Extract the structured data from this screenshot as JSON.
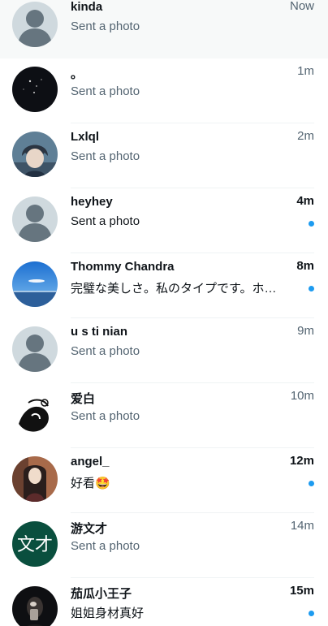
{
  "conversations": [
    {
      "name": "kinda",
      "time": "Now",
      "preview": "Sent a photo",
      "avatar": "default-avatar-icon",
      "unread": false,
      "selected": true
    },
    {
      "name": "。",
      "time": "1m",
      "preview": "Sent a photo",
      "avatar": "night-sky-photo",
      "unread": false,
      "selected": false
    },
    {
      "name": "Lxlql",
      "time": "2m",
      "preview": "Sent a photo",
      "avatar": "anime-boy-photo",
      "unread": false,
      "selected": false
    },
    {
      "name": "heyhey",
      "time": "4m",
      "preview": "Sent a photo",
      "avatar": "default-avatar-icon",
      "unread": true,
      "selected": false
    },
    {
      "name": "Thommy Chandra",
      "time": "8m",
      "preview": "完璧な美しさ。私のタイプです。ホテルで会いましょう",
      "avatar": "blue-sky-photo",
      "unread": true,
      "selected": false
    },
    {
      "name": "u s ti nian",
      "time": "9m",
      "preview": "Sent a photo",
      "avatar": "default-avatar-icon",
      "unread": false,
      "selected": false
    },
    {
      "name": "爱白",
      "time": "10m",
      "preview": "Sent a photo",
      "avatar": "sketch-drawing-photo",
      "unread": false,
      "selected": false
    },
    {
      "name": "angel_",
      "time": "12m",
      "preview": "好看🤩",
      "avatar": "anime-girl-photo",
      "unread": true,
      "selected": false
    },
    {
      "name": "游文才",
      "time": "14m",
      "preview": "Sent a photo",
      "avatar": "initials-avatar",
      "avatar_text": "文才",
      "avatar_color": "#0a4f3e",
      "unread": false,
      "selected": false
    },
    {
      "name": "茄瓜小王子",
      "time": "15m",
      "preview": "姐姐身材真好",
      "avatar": "dark-selfie-photo",
      "unread": true,
      "selected": false
    }
  ],
  "colors": {
    "accent": "#1d9bf0",
    "text_primary": "#0f1419",
    "text_secondary": "#536471",
    "selected_bg": "#f7f9f9",
    "divider": "#eff3f4"
  }
}
